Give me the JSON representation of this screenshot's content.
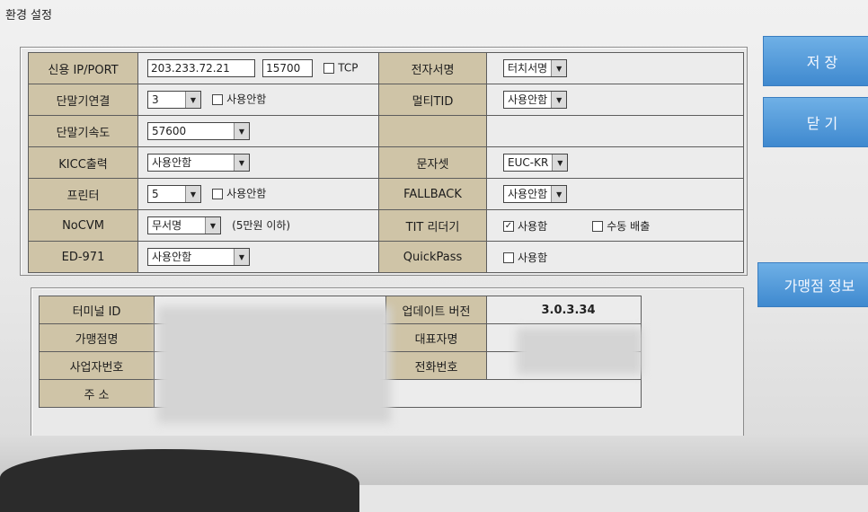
{
  "window": {
    "title": "환경 설정"
  },
  "settings": {
    "ip_port_label": "신용 IP/PORT",
    "ip_value": "203.233.72.21",
    "port_value": "15700",
    "tcp_label": "TCP",
    "terminal_conn_label": "단말기연결",
    "terminal_conn_value": "3",
    "not_used_label": "사용안함",
    "terminal_speed_label": "단말기속도",
    "terminal_speed_value": "57600",
    "kicc_output_label": "KICC출력",
    "kicc_output_value": "사용안함",
    "printer_label": "프린터",
    "printer_value": "5",
    "printer_not_used_label": "사용안함",
    "nocvm_label": "NoCVM",
    "nocvm_value": "무서명",
    "nocvm_note": "(5만원 이하)",
    "ed971_label": "ED-971",
    "ed971_value": "사용안함",
    "esign_label": "전자서명",
    "esign_value": "터치서명",
    "multi_tid_label": "멀티TID",
    "multi_tid_value": "사용안함",
    "charset_label": "문자셋",
    "charset_value": "EUC-KR",
    "fallback_label": "FALLBACK",
    "fallback_value": "사용안함",
    "tit_reader_label": "TIT 리더기",
    "tit_use_label": "사용함",
    "manual_eject_label": "수동 배출",
    "quickpass_label": "QuickPass",
    "quickpass_use_label": "사용함"
  },
  "info": {
    "terminal_id_label": "터미널 ID",
    "merchant_name_label": "가맹점명",
    "business_no_label": "사업자번호",
    "address_label": "주   소",
    "update_version_label": "업데이트 버전",
    "update_version_value": "3.0.3.34",
    "representative_label": "대표자명",
    "phone_label": "전화번호"
  },
  "buttons": {
    "save": "저 장",
    "close": "닫 기",
    "merchant_info": "가맹점 정보"
  },
  "colors": {
    "label_bg": "#cfc4a7",
    "button_blue": "#4f98d8"
  }
}
